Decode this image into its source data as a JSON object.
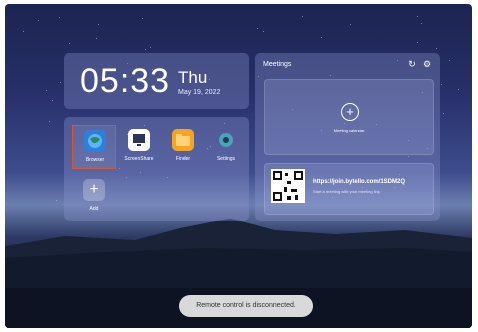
{
  "clock": {
    "time": "05:33",
    "day": "Thu",
    "date": "May 19, 2022"
  },
  "apps": [
    {
      "label": "Browser",
      "icon": "globe-icon",
      "selected": true
    },
    {
      "label": "ScreenShare",
      "icon": "monitor-icon",
      "selected": false
    },
    {
      "label": "Finder",
      "icon": "folder-icon",
      "selected": false
    },
    {
      "label": "Settings",
      "icon": "gear-icon",
      "selected": false
    }
  ],
  "add": {
    "label": "Add"
  },
  "meetings": {
    "title": "Meetings",
    "calendar_label": "Meeting calendar",
    "link": "https://join.bytello.com/1SDM2Q",
    "link_sub": "Start a meeting with your meeting link."
  },
  "toast": "Remote control is disconnected."
}
